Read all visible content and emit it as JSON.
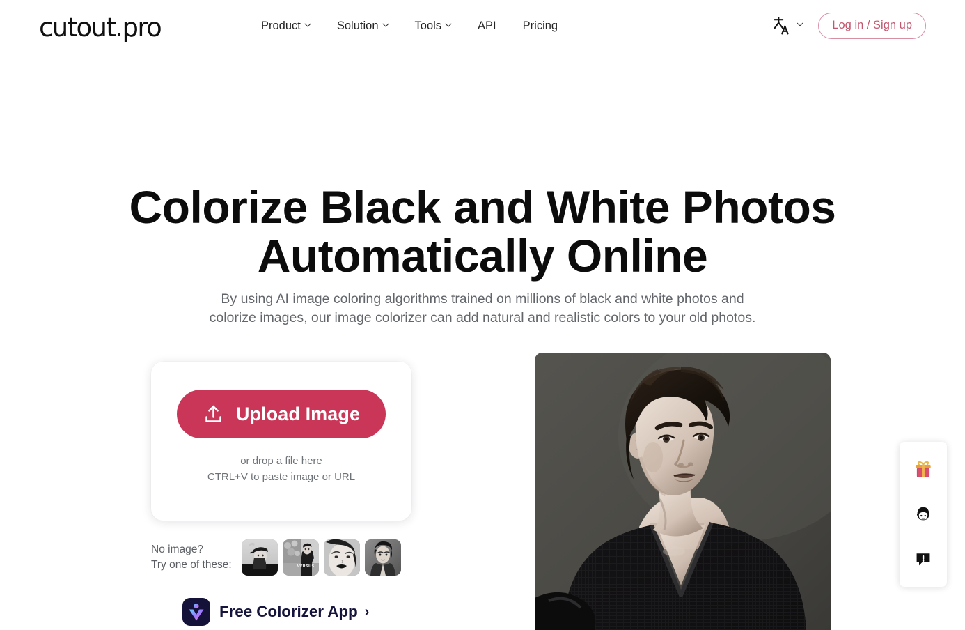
{
  "brand": {
    "logo_text": "cutout.pro",
    "accent_color": "#c93657",
    "login_border_color": "#d98fa3",
    "login_text_color": "#c2566e"
  },
  "header": {
    "nav": [
      {
        "label": "Product",
        "has_dropdown": true,
        "icon": "chevron-down-icon"
      },
      {
        "label": "Solution",
        "has_dropdown": true,
        "icon": "chevron-down-icon"
      },
      {
        "label": "Tools",
        "has_dropdown": true,
        "icon": "chevron-down-icon"
      },
      {
        "label": "API",
        "has_dropdown": false
      },
      {
        "label": "Pricing",
        "has_dropdown": false
      }
    ],
    "language": {
      "icon": "translate-icon",
      "chevron": "chevron-down-icon"
    },
    "login_label": "Log in / Sign up"
  },
  "hero": {
    "title_line1": "Colorize Black and White Photos",
    "title_line2": "Automatically Online",
    "subtitle_line1": "By using AI image coloring algorithms trained on millions of black and white photos and",
    "subtitle_line2": "colorize images, our image colorizer can add natural and realistic colors to your old photos."
  },
  "upload": {
    "button_label": "Upload Image",
    "button_icon": "upload-icon",
    "drop_line1": "or drop a file here",
    "drop_line2": "CTRL+V to paste image or URL"
  },
  "samples": {
    "label_line1": "No image?",
    "label_line2": "Try one of these:",
    "thumbnails": [
      {
        "name": "sample-thumbnail-1",
        "alt": "woman in cap black and white portrait"
      },
      {
        "name": "sample-thumbnail-2",
        "alt": "person in versus sweatshirt street photo"
      },
      {
        "name": "sample-thumbnail-3",
        "alt": "woman with dark lips close-up portrait"
      },
      {
        "name": "sample-thumbnail-4",
        "alt": "young man portrait black and white"
      }
    ]
  },
  "app_promo": {
    "label": "Free Colorizer App",
    "arrow": "›",
    "icon": "colorizer-app-icon"
  },
  "hero_photo": {
    "alt": "black and white portrait of young man in black v-neck sweater"
  },
  "side_widget": {
    "buttons": [
      {
        "name": "gift-icon",
        "title": "Gifts"
      },
      {
        "name": "support-face-icon",
        "title": "Customer Service"
      },
      {
        "name": "feedback-icon",
        "title": "Feedback"
      }
    ]
  }
}
